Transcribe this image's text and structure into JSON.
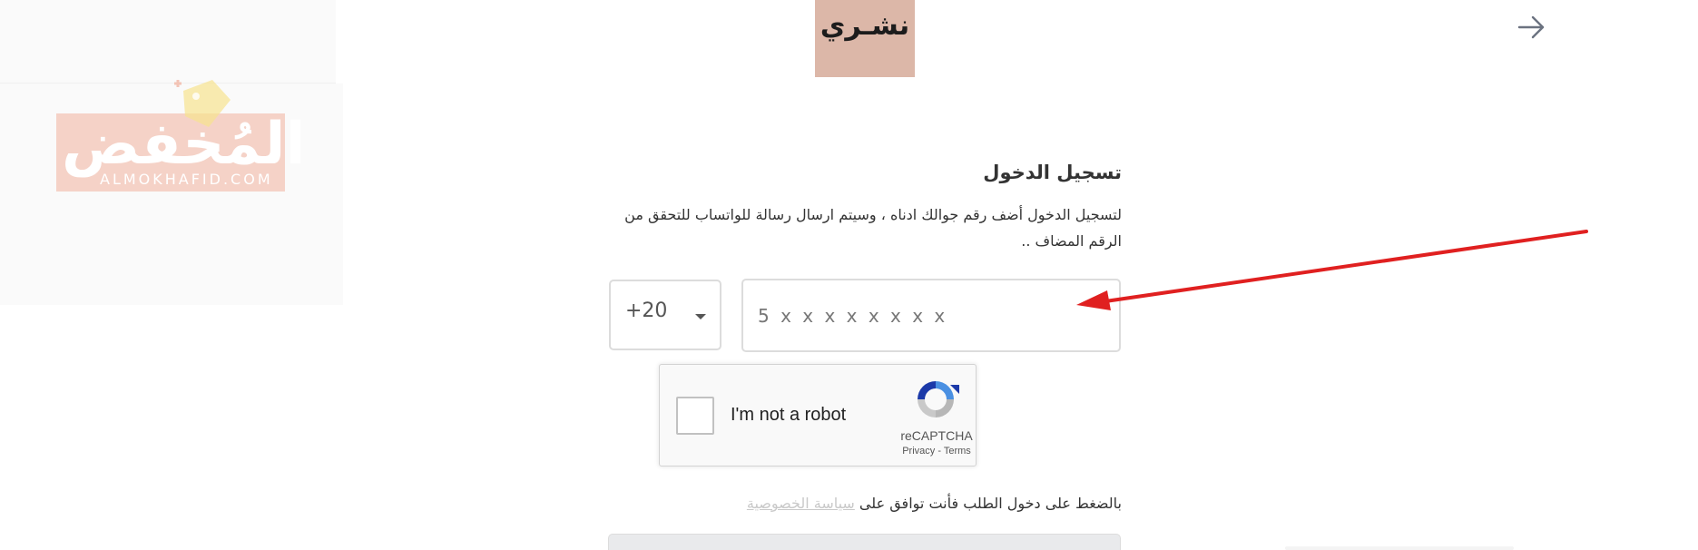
{
  "header": {
    "logo_text": "نشـري",
    "back_icon": "arrow-right-icon"
  },
  "watermark": {
    "arabic": "المُخفض",
    "latin": "ALMOKHAFID.COM"
  },
  "login": {
    "title": "تسجيل الدخول",
    "description": "لتسجيل الدخول أضف رقم جوالك ادناه ، وسيتم ارسال رسالة للواتساب للتحقق من الرقم المضاف ..",
    "country_code": "+20",
    "phone_placeholder": "5 x x x x x x x x",
    "terms_prefix": "بالضغط على دخول الطلب فأنت توافق على ",
    "terms_link": "سياسة الخصوصية"
  },
  "recaptcha": {
    "label": "I'm not a robot",
    "brand": "reCAPTCHA",
    "privacy": "Privacy",
    "separator": " - ",
    "terms": "Terms"
  },
  "colors": {
    "logo_bg": "#dcb7a8",
    "annotation_arrow": "#e02020",
    "input_border": "#dcdcdc"
  }
}
